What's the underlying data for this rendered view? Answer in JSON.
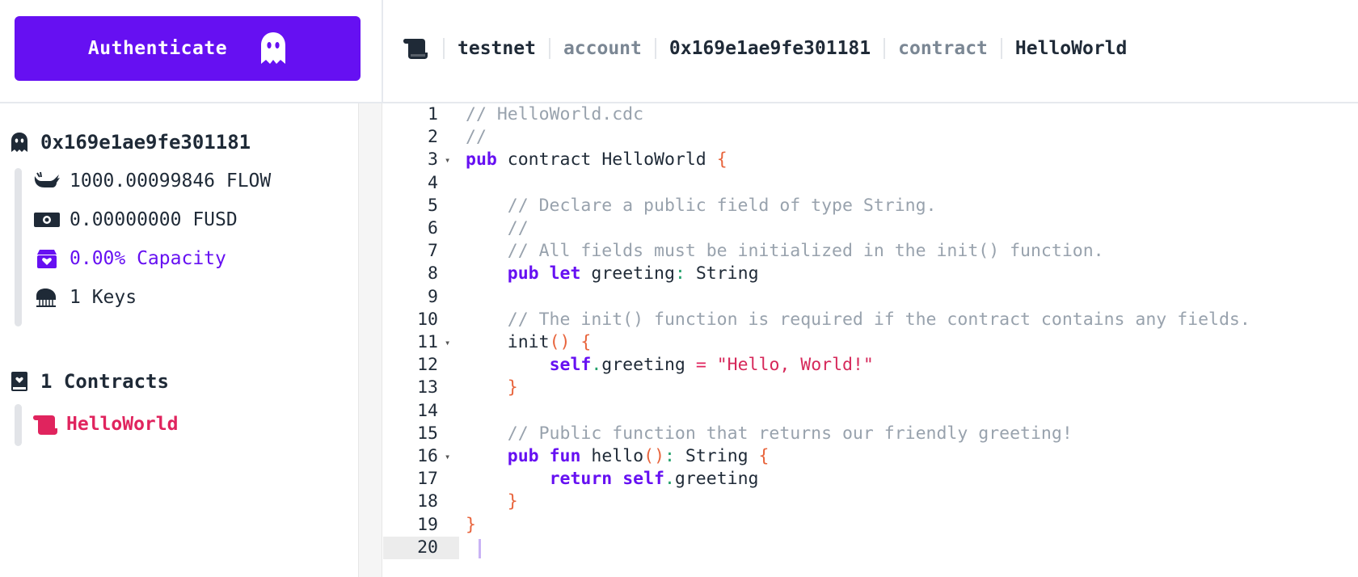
{
  "auth": {
    "label": "Authenticate"
  },
  "breadcrumb": {
    "network": "testnet",
    "account_label": "account",
    "account_address": "0x169e1ae9fe301181",
    "contract_label": "contract",
    "contract_name": "HelloWorld"
  },
  "sidebar": {
    "account_address": "0x169e1ae9fe301181",
    "flow_balance": "1000.00099846 FLOW",
    "fusd_balance": "0.00000000 FUSD",
    "capacity": "0.00% Capacity",
    "keys": "1 Keys",
    "contracts_heading": "1 Contracts",
    "contracts": [
      "HelloWorld"
    ]
  },
  "colors": {
    "accent": "#6610f2",
    "contract": "#e0245e",
    "brace": "#e8643c",
    "comment": "#98a2ad"
  },
  "editor": {
    "lines": [
      {
        "n": "1",
        "t": "// HelloWorld.cdc"
      },
      {
        "n": "2",
        "t": "//"
      },
      {
        "n": "3",
        "t": "pub contract HelloWorld {"
      },
      {
        "n": "4",
        "t": ""
      },
      {
        "n": "5",
        "t": "    // Declare a public field of type String."
      },
      {
        "n": "6",
        "t": "    //"
      },
      {
        "n": "7",
        "t": "    // All fields must be initialized in the init() function."
      },
      {
        "n": "8",
        "t": "    pub let greeting: String"
      },
      {
        "n": "9",
        "t": ""
      },
      {
        "n": "10",
        "t": "    // The init() function is required if the contract contains any fields."
      },
      {
        "n": "11",
        "t": "    init() {"
      },
      {
        "n": "12",
        "t": "        self.greeting = \"Hello, World!\""
      },
      {
        "n": "13",
        "t": "    }"
      },
      {
        "n": "14",
        "t": ""
      },
      {
        "n": "15",
        "t": "    // Public function that returns our friendly greeting!"
      },
      {
        "n": "16",
        "t": "    pub fun hello(): String {"
      },
      {
        "n": "17",
        "t": "        return self.greeting"
      },
      {
        "n": "18",
        "t": "    }"
      },
      {
        "n": "19",
        "t": "}"
      },
      {
        "n": "20",
        "t": ""
      }
    ]
  }
}
